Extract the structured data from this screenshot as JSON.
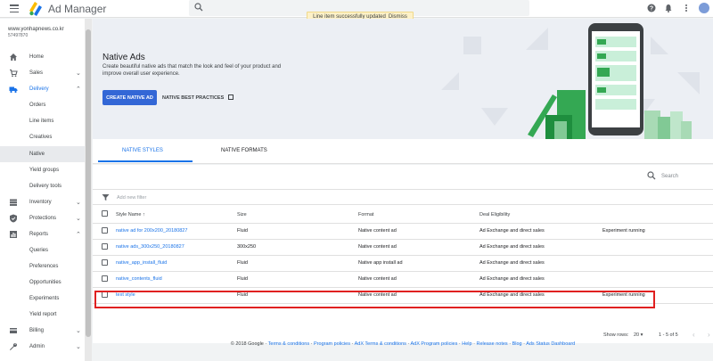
{
  "topbar": {
    "app_title": "Ad Manager",
    "toast_message": "Line item successfully updated",
    "toast_dismiss": "Dismiss"
  },
  "sidebar": {
    "network_url": "www.yonhapnews.co.kr",
    "network_id": "57497870",
    "items": [
      {
        "label": "Home",
        "icon": "home-icon"
      },
      {
        "label": "Sales",
        "icon": "cart-icon"
      },
      {
        "label": "Delivery",
        "icon": "truck-icon"
      },
      {
        "label": "Orders"
      },
      {
        "label": "Line items"
      },
      {
        "label": "Creatives"
      },
      {
        "label": "Native"
      },
      {
        "label": "Yield groups"
      },
      {
        "label": "Delivery tools"
      },
      {
        "label": "Inventory",
        "icon": "inventory-icon"
      },
      {
        "label": "Protections",
        "icon": "shield-icon"
      },
      {
        "label": "Reports",
        "icon": "reports-icon"
      },
      {
        "label": "Queries"
      },
      {
        "label": "Preferences"
      },
      {
        "label": "Opportunities"
      },
      {
        "label": "Experiments"
      },
      {
        "label": "Yield report"
      },
      {
        "label": "Billing",
        "icon": "billing-icon"
      },
      {
        "label": "Admin",
        "icon": "wrench-icon"
      }
    ]
  },
  "hero": {
    "title": "Native Ads",
    "description": "Create beautiful native ads that match the look and feel of your product and improve overall user experience.",
    "create_button": "CREATE NATIVE AD",
    "best_practices": "NATIVE BEST PRACTICES"
  },
  "tabs": [
    "NATIVE STYLES",
    "NATIVE FORMATS"
  ],
  "search": {
    "placeholder": "Search"
  },
  "filter": {
    "placeholder": "Add new filter"
  },
  "table": {
    "headers": [
      "Style Name",
      "Size",
      "Format",
      "Deal Eligibility",
      ""
    ],
    "rows": [
      {
        "name": "native ad for 200x200_20180827",
        "size": "Fluid",
        "format": "Native content ad",
        "deal": "Ad Exchange and direct sales",
        "status": "Experiment running"
      },
      {
        "name": "native ads_300x250_20180827",
        "size": "300x250",
        "format": "Native content ad",
        "deal": "Ad Exchange and direct sales",
        "status": ""
      },
      {
        "name": "native_app_install_fluid",
        "size": "Fluid",
        "format": "Native app install ad",
        "deal": "Ad Exchange and direct sales",
        "status": ""
      },
      {
        "name": "native_contents_fluid",
        "size": "Fluid",
        "format": "Native content ad",
        "deal": "Ad Exchange and direct sales",
        "status": ""
      },
      {
        "name": "text style",
        "size": "Fluid",
        "format": "Native content ad",
        "deal": "Ad Exchange and direct sales",
        "status": "Experiment running"
      }
    ]
  },
  "pager": {
    "show_rows_label": "Show rows:",
    "rows_value": "20",
    "range": "1 - 5 of 5"
  },
  "footer": {
    "copyright": "© 2018 Google",
    "links": [
      "Terms & conditions",
      "Program policies",
      "AdX Terms & conditions",
      "AdX Program policies",
      "Help",
      "Release notes",
      "Blog",
      "Ads Status Dashboard"
    ]
  },
  "colors": {
    "accent": "#1a73e8",
    "primary_button": "#3367d6",
    "highlight": "#e02020",
    "toast_bg": "#fdf1c7"
  }
}
